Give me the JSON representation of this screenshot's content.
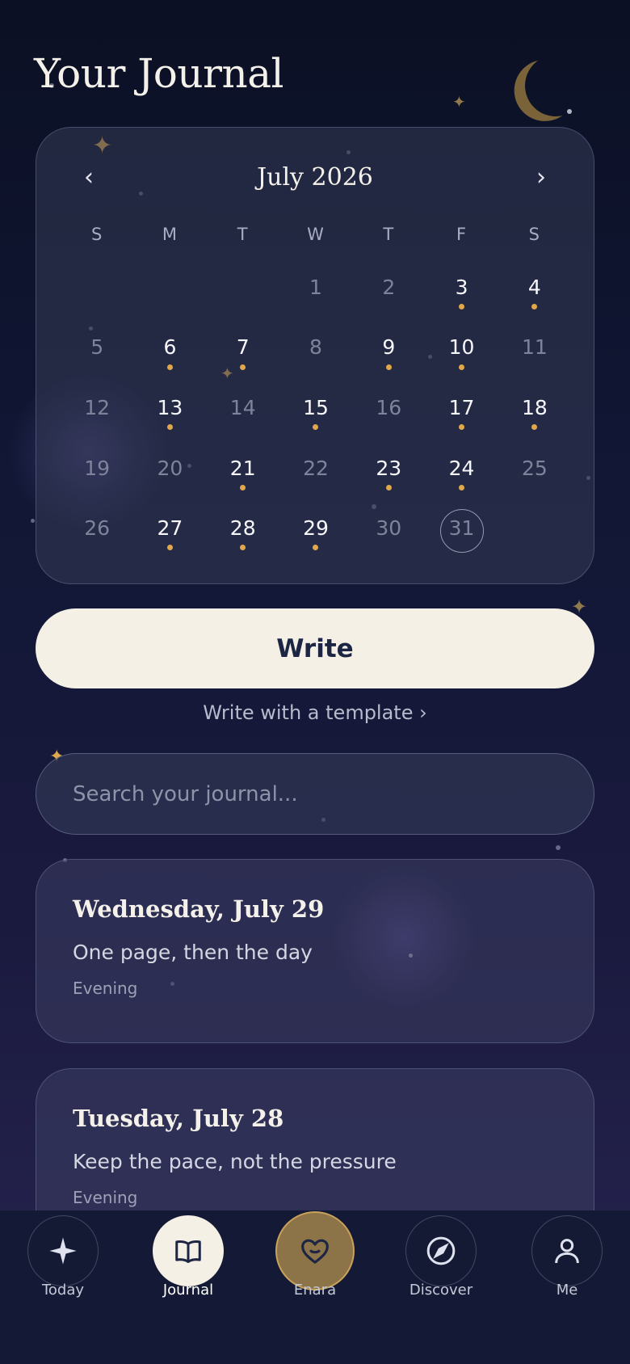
{
  "header": {
    "title": "Your Journal"
  },
  "calendar": {
    "month_label": "July 2026",
    "prev_label": "‹",
    "next_label": "›",
    "weekdays": [
      "S",
      "M",
      "T",
      "W",
      "T",
      "F",
      "S"
    ],
    "leading_blanks": 3,
    "days": [
      {
        "n": "1",
        "entry": false
      },
      {
        "n": "2",
        "entry": false
      },
      {
        "n": "3",
        "entry": true
      },
      {
        "n": "4",
        "entry": true
      },
      {
        "n": "5",
        "entry": false
      },
      {
        "n": "6",
        "entry": true
      },
      {
        "n": "7",
        "entry": true
      },
      {
        "n": "8",
        "entry": false
      },
      {
        "n": "9",
        "entry": true
      },
      {
        "n": "10",
        "entry": true
      },
      {
        "n": "11",
        "entry": false
      },
      {
        "n": "12",
        "entry": false
      },
      {
        "n": "13",
        "entry": true
      },
      {
        "n": "14",
        "entry": false
      },
      {
        "n": "15",
        "entry": true
      },
      {
        "n": "16",
        "entry": false
      },
      {
        "n": "17",
        "entry": true
      },
      {
        "n": "18",
        "entry": true
      },
      {
        "n": "19",
        "entry": false
      },
      {
        "n": "20",
        "entry": false
      },
      {
        "n": "21",
        "entry": true
      },
      {
        "n": "22",
        "entry": false
      },
      {
        "n": "23",
        "entry": true
      },
      {
        "n": "24",
        "entry": true
      },
      {
        "n": "25",
        "entry": false
      },
      {
        "n": "26",
        "entry": false
      },
      {
        "n": "27",
        "entry": true
      },
      {
        "n": "28",
        "entry": true
      },
      {
        "n": "29",
        "entry": true
      },
      {
        "n": "30",
        "entry": false
      },
      {
        "n": "31",
        "entry": false,
        "today": true
      }
    ]
  },
  "write_button": {
    "label": "Write"
  },
  "template_link": {
    "label": "Write with a template ›"
  },
  "search": {
    "placeholder": "Search your journal..."
  },
  "entries": [
    {
      "date": "Wednesday, July 29",
      "title": "One page, then the day",
      "tag": "Evening"
    },
    {
      "date": "Tuesday, July 28",
      "title": "Keep the pace, not the pressure",
      "tag": "Evening"
    }
  ],
  "nav": [
    {
      "label": "Today",
      "icon": "sparkle-icon"
    },
    {
      "label": "Journal",
      "icon": "book-icon",
      "active": true
    },
    {
      "label": "Enara",
      "icon": "heart-icon"
    },
    {
      "label": "Discover",
      "icon": "compass-icon"
    },
    {
      "label": "Me",
      "icon": "person-icon"
    }
  ],
  "colors": {
    "accent_gold": "#e0a84a",
    "cream": "#f4f0e6",
    "navy_text": "#1c2544",
    "background_top": "#0b1024",
    "background_bottom": "#272551"
  }
}
